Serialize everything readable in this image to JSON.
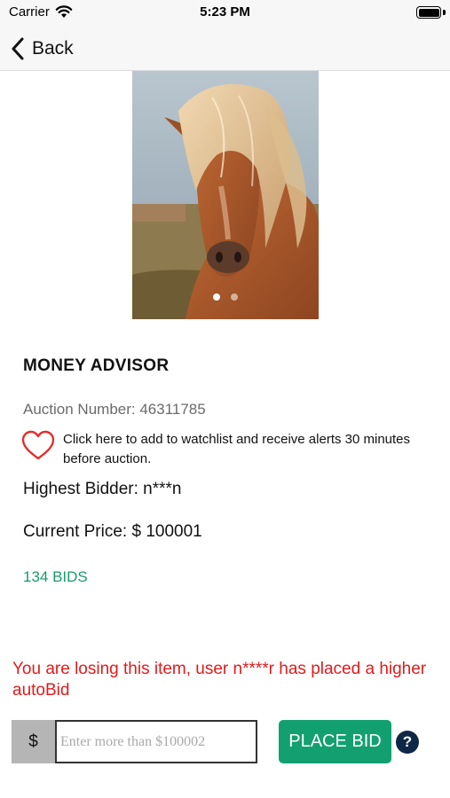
{
  "status_bar": {
    "carrier": "Carrier",
    "time": "5:23 PM",
    "wifi_icon": "wifi-icon",
    "battery_icon": "battery-icon"
  },
  "nav": {
    "back_label": "Back",
    "back_icon": "chevron-left-icon"
  },
  "gallery": {
    "image_subject": "horse-photo",
    "page_count": 2,
    "current_page": 1
  },
  "item": {
    "title": "MONEY ADVISOR",
    "auction_number": "Auction Number: 46311785",
    "watchlist_icon": "heart-outline-icon",
    "watchlist_text": "Click here to add to watchlist and receive alerts 30 minutes before auction.",
    "highest_bidder": "Highest Bidder: n***n",
    "current_price": "Current Price: $ 100001",
    "bids_count": "134 BIDS"
  },
  "alert": {
    "message": "You are losing this item, user n****r has placed a higher autoBid"
  },
  "bid_form": {
    "currency_symbol": "$",
    "input_value": "",
    "input_placeholder": "Enter more than $100002",
    "place_bid_label": "PLACE BID",
    "help_label": "?"
  },
  "colors": {
    "accent_green": "#13a070",
    "bids_green": "#1a9a6b",
    "alert_red": "#e01b1b",
    "heart_red": "#e0302f",
    "help_navy": "#0f2747"
  }
}
